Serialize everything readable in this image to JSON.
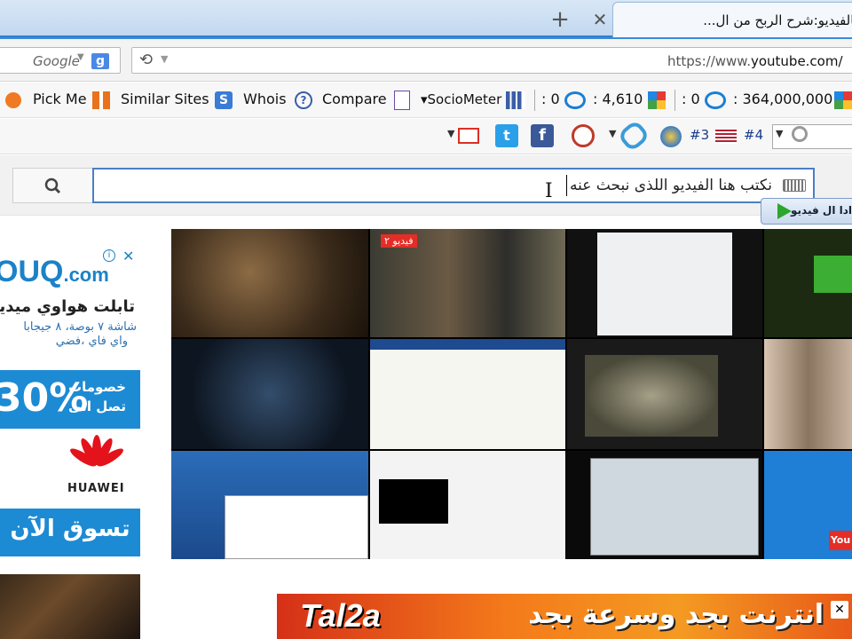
{
  "tabs": {
    "active_title": "بالفيديو:شرح الربح من ال...",
    "close_symbol": "✕",
    "new_tab_symbol": "+"
  },
  "navbar": {
    "search_placeholder": "Google",
    "search_engine_icon": "g",
    "url_prefix": "https://www.",
    "url_domain": "youtube.com/",
    "reload_icon": "⟲"
  },
  "toolbar": {
    "pick_me": "Pick Me",
    "similar_sites": "Similar Sites",
    "whois": "Whois",
    "compare": "Compare",
    "sociometer": "SocioMeter",
    "stat1": ": 0",
    "stat2": ": 4,610",
    "stat3": ": 0",
    "stat4": ": 364,000,000",
    "rank3": "#3",
    "rank4": "#4"
  },
  "youtube": {
    "search_text": "نكتب هنا الفيديو اللذى نبحث عنه",
    "tooltip": "ادا ال فيديو",
    "cursor_glyph": "I"
  },
  "ad": {
    "brand": "OUQ",
    "brand_suffix": ".com",
    "info": "i",
    "close": "✕",
    "line1": "تابلت هواوي ميديابا",
    "line2": "شاشة ٧ بوصة، ٨ جيجابا",
    "line3": "واي فاي ،فضي",
    "percent": "30%",
    "promo1": "خصومات",
    "promo2": "تصل الى",
    "huawei": "HUAWEI",
    "shop": "تسوق الآن"
  },
  "grid": {
    "c2_badge": "فيديو ٢",
    "c12_badge": "You"
  },
  "banner": {
    "logo": "Tal2a",
    "text": "انترنت بجد وسرعة بجد",
    "close": "✕"
  },
  "colors": {
    "tab_accent": "#2f7fd0",
    "search_border": "#4a7fc4",
    "ad_blue": "#1d8ad4",
    "banner_orange": "#f47a1a"
  }
}
